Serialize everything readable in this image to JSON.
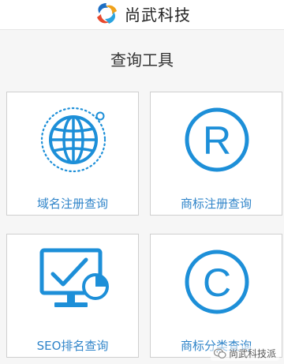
{
  "header": {
    "brand_name": "尚武科技",
    "logo_icon": "brand-swirl-logo"
  },
  "section": {
    "title": "查询工具"
  },
  "tools": [
    {
      "label": "域名注册查询",
      "icon": "globe-icon"
    },
    {
      "label": "商标注册查询",
      "icon": "registered-trademark-icon"
    },
    {
      "label": "SEO排名查询",
      "icon": "monitor-chart-icon"
    },
    {
      "label": "商标分类查询",
      "icon": "copyright-icon"
    }
  ],
  "watermark": {
    "text": "尚武科技派",
    "icon": "wechat-icon"
  },
  "colors": {
    "accent": "#2f84c9",
    "icon_blue": "#1d8fd8",
    "border": "#cfcfcf",
    "background": "#f6f6f6"
  }
}
